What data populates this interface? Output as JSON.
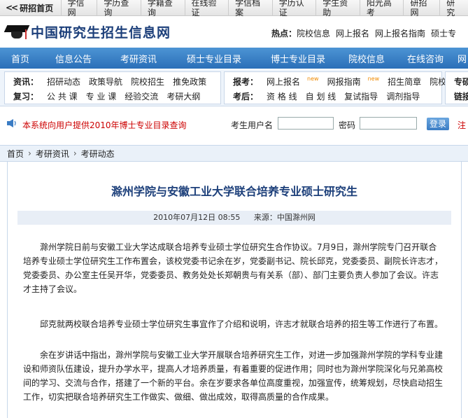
{
  "topbar": {
    "home_icon": "<<",
    "home_label": "研招首页",
    "items": [
      "学信网",
      "学历查询",
      "学籍查询",
      "在线验证",
      "学信档案",
      "学历认证",
      "学生资助",
      "阳光高考",
      "研招网",
      "研究"
    ]
  },
  "brand": {
    "title": "中国研究生招生信息网",
    "hot_label": "热点：",
    "hot_items": [
      "院校信息",
      "网上报名",
      "网上报名指南",
      "硕士专"
    ]
  },
  "nav": {
    "items": [
      "首页",
      "信息公告",
      "考研资讯",
      "硕士专业目录",
      "博士专业目录",
      "院校信息",
      "在线咨询",
      "网"
    ]
  },
  "subnav": {
    "box1": {
      "row1_label": "资讯：",
      "row1": [
        "招研动态",
        "政策导航",
        "院校招生",
        "推免政策"
      ],
      "row2_label": "复习：",
      "row2": [
        "公 共 课",
        "专 业 课",
        "经验交流",
        "考研大纲"
      ]
    },
    "box2": {
      "row1_label": "报考：",
      "row1": [
        "网上报名",
        "网报指南",
        "招生简章",
        "院校政策"
      ],
      "row2_label": "考后：",
      "row2": [
        "资 格 线",
        "自 划 线",
        "复试指导",
        "调剂指导"
      ],
      "new_tag": "new"
    },
    "box3": {
      "row1_label": "专硕",
      "row2_label": "链接"
    }
  },
  "login": {
    "notice": "本系统向用户提供2010年博士专业目录查询",
    "username_label": "考生用户名",
    "password_label": "密码",
    "username_value": "",
    "password_value": "",
    "submit_label": "登录",
    "extra": "注"
  },
  "breadcrumb": [
    "首页",
    "考研资讯",
    "考研动态"
  ],
  "article": {
    "title": "滁州学院与安徽工业大学联合培养专业硕士研究生",
    "date": "2010年07月12日 08:55",
    "source": "来源：中国滁州网",
    "paragraphs": [
      "滁州学院日前与安徽工业大学达成联合培养专业硕士学位研究生合作协议。7月9日，滁州学院专门召开联合培养专业硕士学位研究生工作布置会，该校党委书记余在岁，党委副书记、院长邱克，党委委员、副院长许志才，党委委员、办公室主任吴开华，党委委员、教务处处长郑朝贵与有关系（部）、部门主要负责人参加了会议。许志才主持了会议。",
      "邱克就两校联合培养专业硕士学位研究生事宜作了介绍和说明，许志才就联合培养的招生等工作进行了布置。",
      "余在岁讲话中指出，滁州学院与安徽工业大学开展联合培养研究生工作，对进一步加强滁州学院的学科专业建设和师资队伍建设，提升办学水平，提高人才培养质量，有着重要的促进作用；同时也为滁州学院深化与兄弟高校间的学习、交流与合作，搭建了一个新的平台。余在岁要求各单位高度重视，加强宣传，统筹规划，尽快启动招生工作，切实把联合培养研究生工作做实、做细、做出成效，取得高质量的合作成果。"
    ]
  }
}
